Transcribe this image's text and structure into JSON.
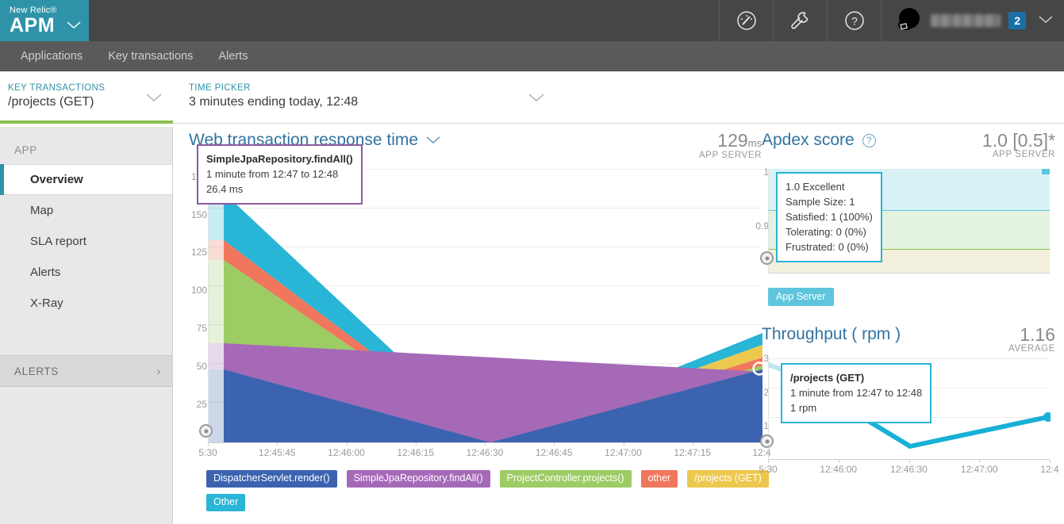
{
  "topbar": {
    "brand_sub": "New Relic®",
    "brand_main": "APM",
    "brand_caret": "⌄",
    "icons": [
      {
        "name": "gauge-icon",
        "label": "Browser"
      },
      {
        "name": "wrench-icon",
        "label": "Tools"
      },
      {
        "name": "help-icon",
        "label": "Help"
      }
    ],
    "user_name_masked": "",
    "badge": "2",
    "user_caret": "⌄"
  },
  "subnav": {
    "items": [
      "Applications",
      "Key transactions",
      "Alerts"
    ]
  },
  "context": {
    "left_kicker": "KEY TRANSACTIONS",
    "left_value": "/projects (GET)",
    "right_kicker": "TIME PICKER",
    "right_value": "3 minutes ending today, 12:48",
    "caret": "⌄"
  },
  "sidebar": {
    "section_label": "APP",
    "items": [
      {
        "label": "Overview",
        "active": true
      },
      {
        "label": "Map",
        "active": false
      },
      {
        "label": "SLA report",
        "active": false
      },
      {
        "label": "Alerts",
        "active": false
      },
      {
        "label": "X-Ray",
        "active": false
      }
    ],
    "group_label": "ALERTS",
    "group_chevron": "›"
  },
  "main_chart": {
    "title": "Web transaction response time",
    "caret": "⌄",
    "metric_value": "129",
    "metric_unit": "ms",
    "metric_sub": "APP SERVER",
    "tooltip": {
      "title": "SimpleJpaRepository.findAll()",
      "range": "1 minute from 12:47 to 12:48",
      "value": "26.4 ms"
    }
  },
  "apdex": {
    "title": "Apdex score",
    "help_icon": "?",
    "metric_value": "1.0 [0.5]*",
    "metric_sub": "APP SERVER",
    "y_ticks": [
      "1",
      "0.9"
    ],
    "button_label": "App Server",
    "tooltip": {
      "line1": "1.0 Excellent",
      "line2": "Sample Size: 1",
      "line3": "Satisfied: 1 (100%)",
      "line4": "Tolerating: 0 (0%)",
      "line5": "Frustrated: 0 (0%)"
    }
  },
  "throughput": {
    "title": "Throughput ( rpm )",
    "metric_value": "1.16",
    "metric_sub": "AVERAGE",
    "tooltip": {
      "title": "/projects (GET)",
      "range": "1 minute from 12:47 to 12:48",
      "value": "1 rpm"
    }
  },
  "legend": [
    {
      "label": "DispatcherServlet.render()",
      "color": "#3c63b0"
    },
    {
      "label": "SimpleJpaRepository.findAll()",
      "color": "#a569b8"
    },
    {
      "label": "ProjectController.projects()",
      "color": "#9dcc65"
    },
    {
      "label": "other",
      "color": "#f0775d"
    },
    {
      "label": "/projects (GET)",
      "color": "#edc84f"
    },
    {
      "label": "Other",
      "color": "#29b5d6"
    }
  ],
  "chart_data": [
    {
      "type": "area",
      "id": "web-transaction-response-time",
      "title": "Web transaction response time",
      "xlabel": "",
      "ylabel": "ms",
      "ylim": [
        0,
        180
      ],
      "y_ticks": [
        25,
        50,
        75,
        100,
        125,
        150,
        175
      ],
      "grid": true,
      "legend_position": "bottom",
      "x_ticks": [
        "5:30",
        "12:45:45",
        "12:46:00",
        "12:46:15",
        "12:46:30",
        "12:46:45",
        "12:47:00",
        "12:47:15",
        "12:4"
      ],
      "x": [
        "12:45:30",
        "12:46:30",
        "12:48:00"
      ],
      "stacked": true,
      "series": [
        {
          "name": "DispatcherServlet.render()",
          "color": "#3c63b0",
          "values": [
            40,
            0,
            57
          ]
        },
        {
          "name": "SimpleJpaRepository.findAll()",
          "color": "#a569b8",
          "values": [
            17,
            0,
            48
          ]
        },
        {
          "name": "ProjectController.projects()",
          "color": "#9dcc65",
          "values": [
            55,
            0,
            4
          ]
        },
        {
          "name": "other",
          "color": "#f0775d",
          "values": [
            13,
            0,
            5
          ]
        },
        {
          "name": "/projects (GET)",
          "color": "#edc84f",
          "values": [
            0,
            0,
            8
          ]
        },
        {
          "name": "Other",
          "color": "#29b5d6",
          "values": [
            40,
            0,
            7
          ]
        }
      ],
      "endpoint_marker": {
        "x": "12:48:00",
        "y": 129
      }
    },
    {
      "type": "area",
      "id": "apdex-score",
      "title": "Apdex score",
      "ylim": [
        0.85,
        1.0
      ],
      "y_ticks": [
        1,
        0.9
      ],
      "grid": true,
      "bands": [
        {
          "name": "satisfied",
          "color": "#d9f2f6"
        },
        {
          "name": "tolerating",
          "color": "#e4f3e0"
        },
        {
          "name": "frustrated",
          "color": "#f2f0dc"
        }
      ],
      "values": [
        1.0,
        1.0,
        1.0
      ],
      "average": "1.0 [0.5]*"
    },
    {
      "type": "line",
      "id": "throughput-rpm",
      "title": "Throughput ( rpm )",
      "ylabel": "rpm",
      "ylim": [
        0,
        3
      ],
      "y_ticks": [
        1,
        2,
        3
      ],
      "grid": true,
      "x_ticks": [
        "5:30",
        "12:46:00",
        "12:46:30",
        "12:47:00",
        "12:4"
      ],
      "x": [
        "12:45:30",
        "12:46:30",
        "12:48:00"
      ],
      "series": [
        {
          "name": "/projects (GET)",
          "color": "#29b5d6",
          "values": [
            3,
            0,
            1
          ]
        }
      ],
      "average": 1.16
    }
  ]
}
